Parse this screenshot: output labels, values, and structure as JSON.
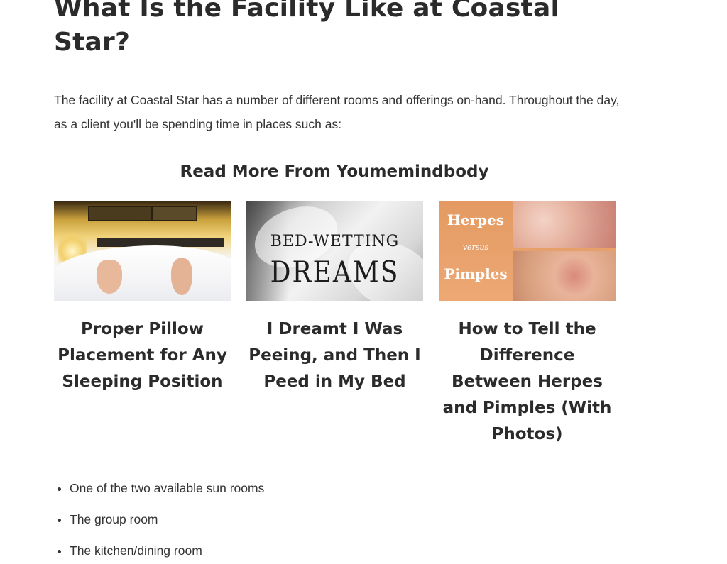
{
  "article": {
    "heading": "What Is the Facility Like at Coastal Star?",
    "intro": "The facility at Coastal Star has a number of different rooms and offerings on-hand. Throughout the day, as a client you'll be spending time in places such as:"
  },
  "read_more": {
    "title": "Read More From Youmemindbody",
    "cards": [
      {
        "title": "Proper Pillow Placement for Any Sleeping Position",
        "image_icon": "bed-feet-photo"
      },
      {
        "title": "I Dreamt I Was Peeing, and Then I Peed in My Bed",
        "image_icon": "bed-wetting-dreams-photo",
        "image_text_line1": "BED-WETTING",
        "image_text_line2": "DREAMS"
      },
      {
        "title": "How to Tell the Difference Between Herpes and Pimples (With Photos)",
        "image_icon": "herpes-vs-pimples-photo",
        "image_text_line1": "Herpes",
        "image_text_line2": "versus",
        "image_text_line3": "Pimples"
      }
    ]
  },
  "list": {
    "items": [
      "One of the two available sun rooms",
      "The group room",
      "The kitchen/dining room"
    ]
  }
}
